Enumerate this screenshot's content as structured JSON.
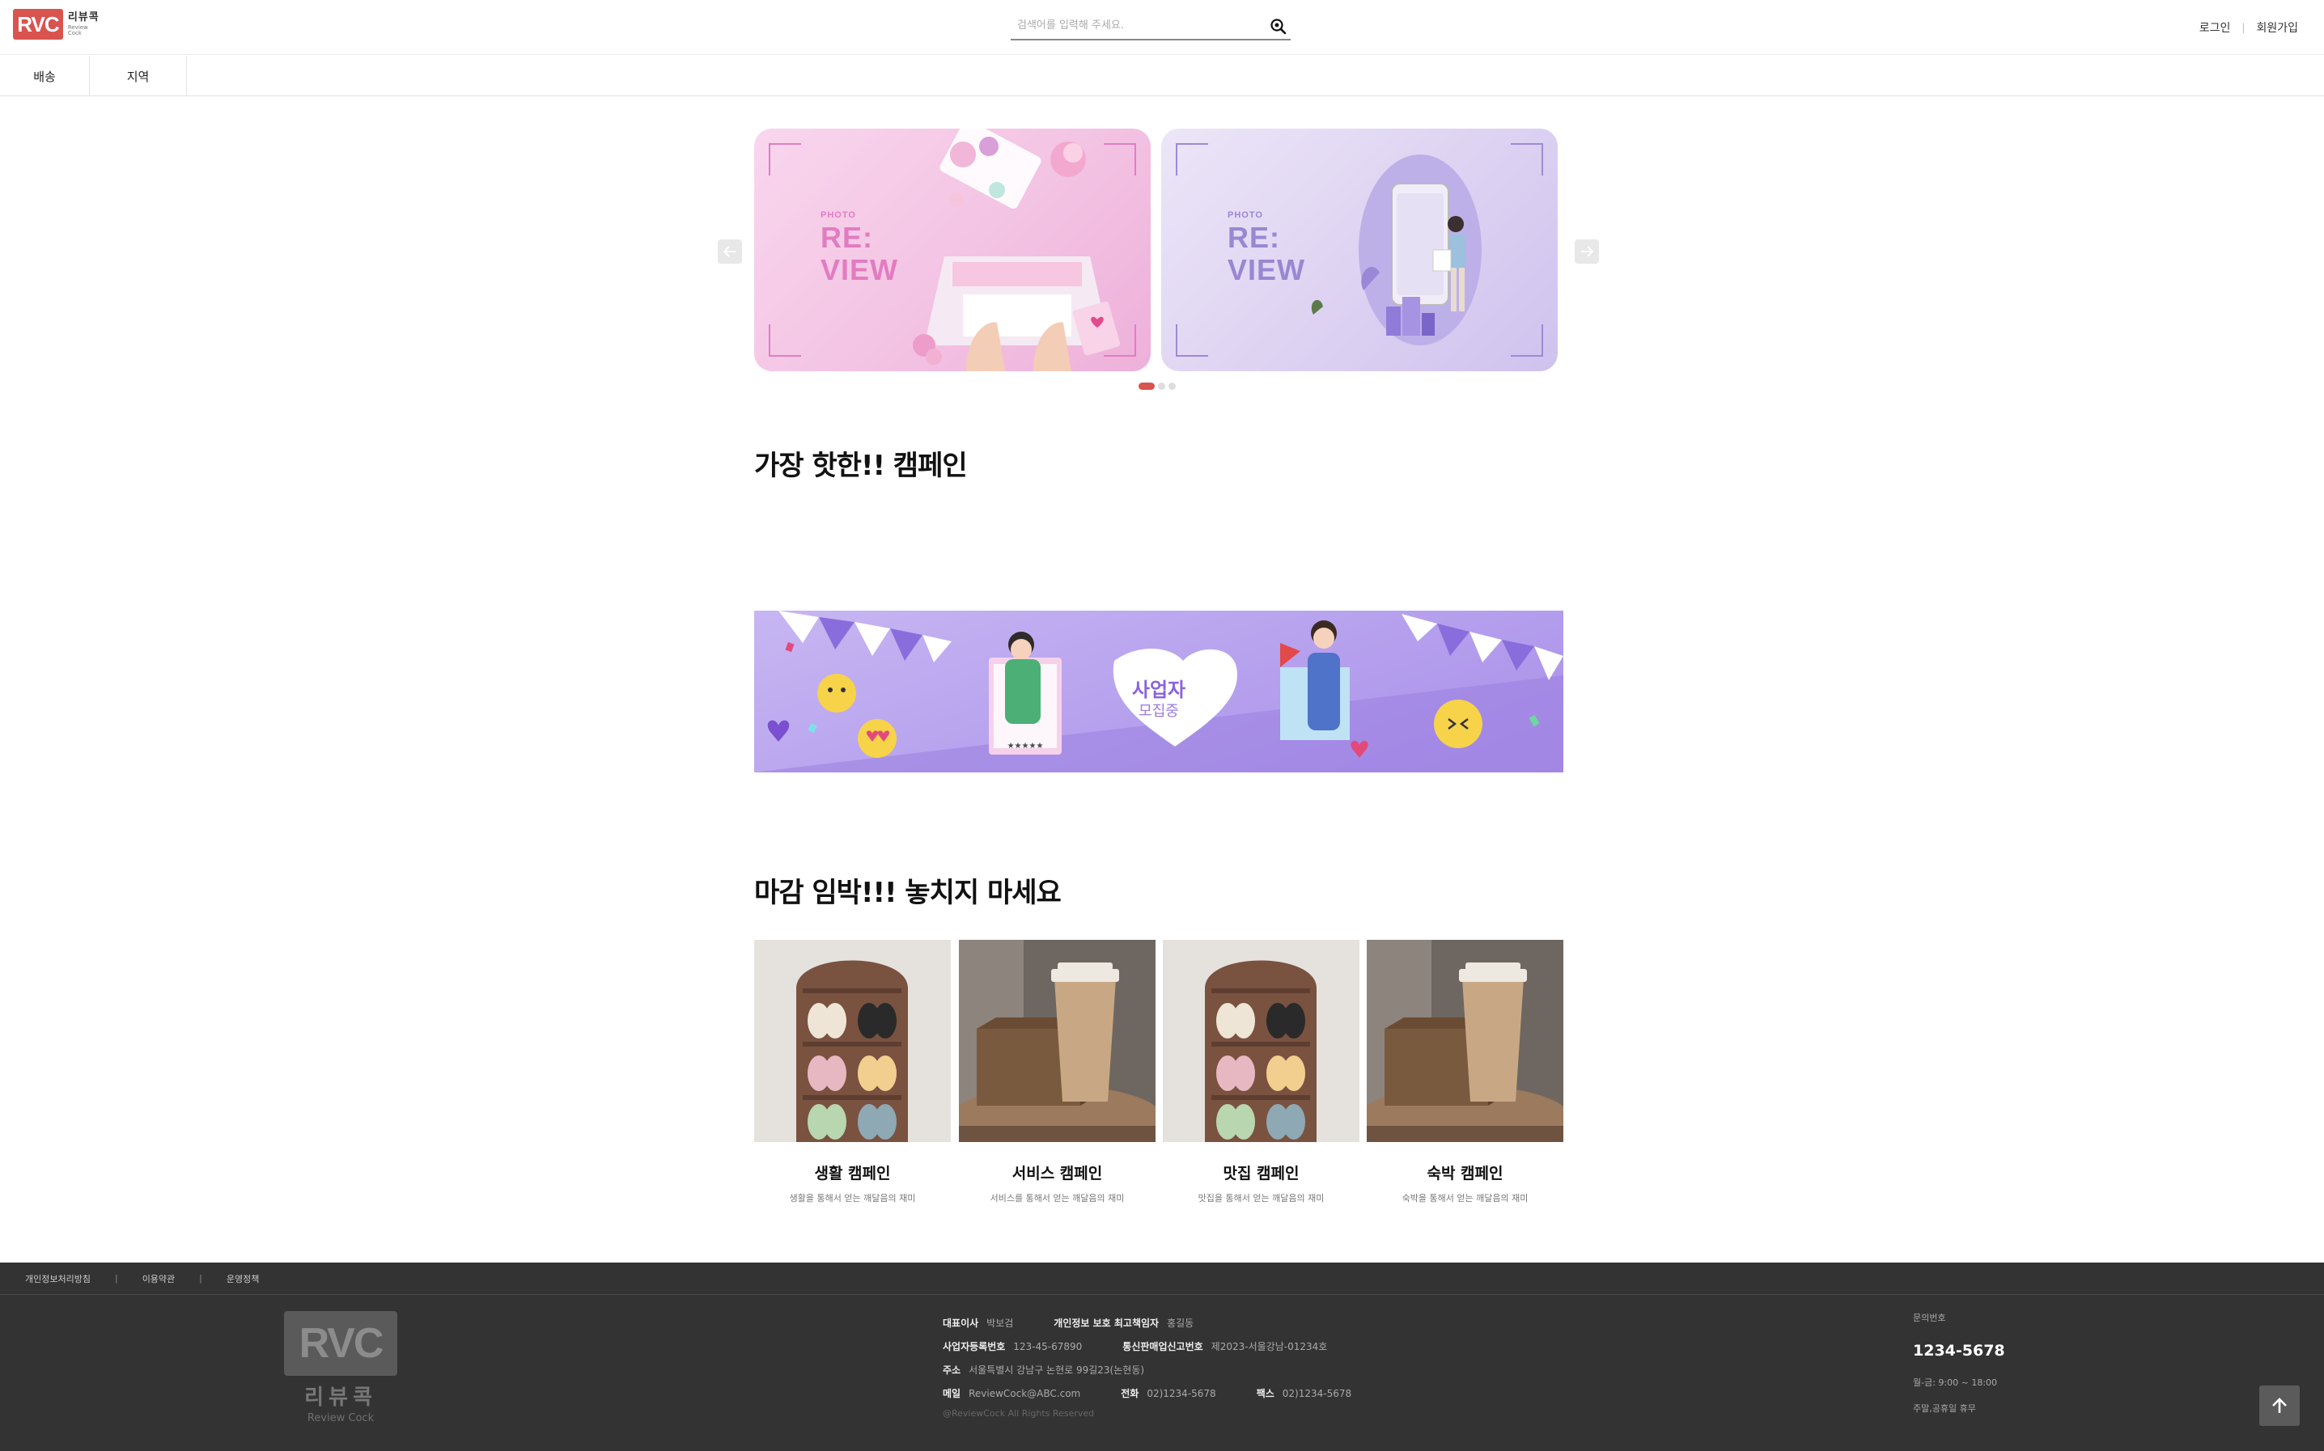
{
  "header": {
    "logo_mark": "RVC",
    "logo_ko": "리뷰콕",
    "logo_en": "Review Cock",
    "search_placeholder": "검색어를 입력해 주세요.",
    "login": "로그인",
    "signup": "회원가입"
  },
  "nav": {
    "items": [
      {
        "label": "배송"
      },
      {
        "label": "지역"
      }
    ]
  },
  "carousel": {
    "slides": [
      {
        "photo": "PHOTO",
        "line1": "RE:",
        "line2": "VIEW"
      },
      {
        "photo": "PHOTO",
        "line1": "RE:",
        "line2": "VIEW"
      }
    ],
    "dot_count": 3,
    "active_dot": 0
  },
  "sections": {
    "hot_title": "가장 핫한!! 캠페인",
    "deadline_title": "마감 임박!!! 놓치지 마세요"
  },
  "banner": {
    "title": "사업자",
    "subtitle": "모집중",
    "stars": "★★★★★"
  },
  "cards": [
    {
      "title": "생활 캠페인",
      "desc": "생활을 통해서 얻는 깨달음의 재미",
      "image": "slippers"
    },
    {
      "title": "서비스 캠페인",
      "desc": "서비스를 통해서 얻는 깨달음의 재미",
      "image": "coffee"
    },
    {
      "title": "맛집 캠페인",
      "desc": "맛집을 통해서 얻는 깨달음의 재미",
      "image": "slippers"
    },
    {
      "title": "숙박 캠페인",
      "desc": "숙박을 통해서 얻는 깨달음의 재미",
      "image": "coffee"
    }
  ],
  "footer": {
    "links": [
      "개인정보처리방침",
      "이용약관",
      "운영정책"
    ],
    "logo_mark": "RVC",
    "logo_ko": "리뷰콕",
    "logo_en": "Review Cock",
    "ceo_label": "대표이사",
    "ceo": "박보검",
    "privacy_label": "개인정보 보호 최고책임자",
    "privacy": "홍길동",
    "biz_label": "사업자등록번호",
    "biz": "123-45-67890",
    "mail_order_label": "통신판매업신고번호",
    "mail_order": "제2023-서울강남-01234호",
    "address_label": "주소",
    "address": "서울특별시 강남구 논현로 99길23(논현동)",
    "email_label": "메일",
    "email": "ReviewCock@ABC.com",
    "tel_label": "전화",
    "tel": "02)1234-5678",
    "fax_label": "팩스",
    "fax": "02)1234-5678",
    "copyright": "@ReviewCock All Rights Reserved",
    "contact_label": "문의번호",
    "contact_phone": "1234-5678",
    "hours": "월-금: 9:00 ~ 18:00",
    "holiday": "주말,공휴일 휴무"
  },
  "colors": {
    "brand": "#d9534f",
    "footer_bg": "#333333",
    "banner_purple": "#b7a2ee"
  }
}
